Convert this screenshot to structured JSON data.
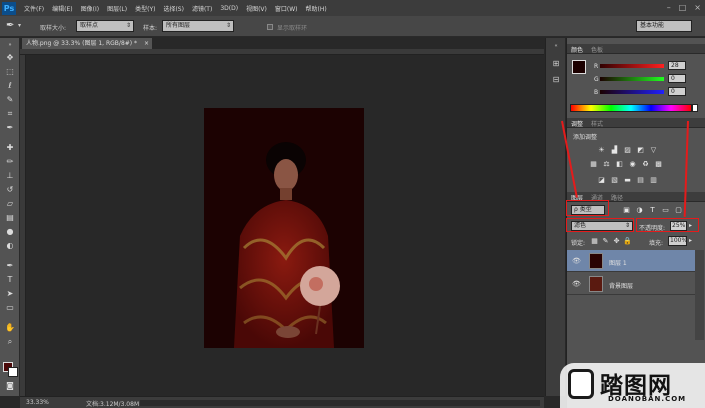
{
  "app": {
    "logo": "Ps",
    "menu": [
      "文件(F)",
      "编辑(E)",
      "图像(I)",
      "图层(L)",
      "类型(Y)",
      "选择(S)",
      "滤镜(T)",
      "3D(D)",
      "视图(V)",
      "窗口(W)",
      "帮助(H)"
    ],
    "window_controls": [
      "–",
      "□",
      "×"
    ]
  },
  "options_bar": {
    "tool_icon": "eyedropper-icon",
    "sample_size_label": "取样大小:",
    "sample_size_value": "取样点",
    "sample_label": "样本:",
    "sample_value": "所有图层",
    "show_ring_label": "显示取样环",
    "workspace_value": "基本功能"
  },
  "document": {
    "tab_title": "人物.png @ 33.3% (图层 1, RGB/8#) *",
    "close": "×"
  },
  "status": {
    "zoom": "33.33%",
    "doc_size": "文档:3.12M/3.08M"
  },
  "color_panel": {
    "tabs": [
      "颜色",
      "色板"
    ],
    "channels": [
      {
        "label": "R",
        "value": "28",
        "color_end": "#ff2020"
      },
      {
        "label": "G",
        "value": "0",
        "color_end": "#20ff20"
      },
      {
        "label": "B",
        "value": "0",
        "color_end": "#2020ff"
      }
    ],
    "foreground": "#1c0000"
  },
  "adjustments_panel": {
    "tabs": [
      "调整",
      "样式"
    ],
    "title": "添加调整"
  },
  "layers_panel": {
    "tabs": [
      "图层",
      "通道",
      "路径"
    ],
    "filter_label": "ρ 类型",
    "blend_mode": "滤色",
    "opacity_label": "不透明度:",
    "opacity_value": "25%",
    "lock_label": "锁定:",
    "fill_label": "填充:",
    "fill_value": "100%",
    "layers": [
      {
        "name": "图层 1",
        "selected": true
      },
      {
        "name": "背景图层",
        "selected": false
      }
    ]
  },
  "watermark": {
    "main": "踏图网",
    "sub": "DOANOBAN.COM"
  }
}
